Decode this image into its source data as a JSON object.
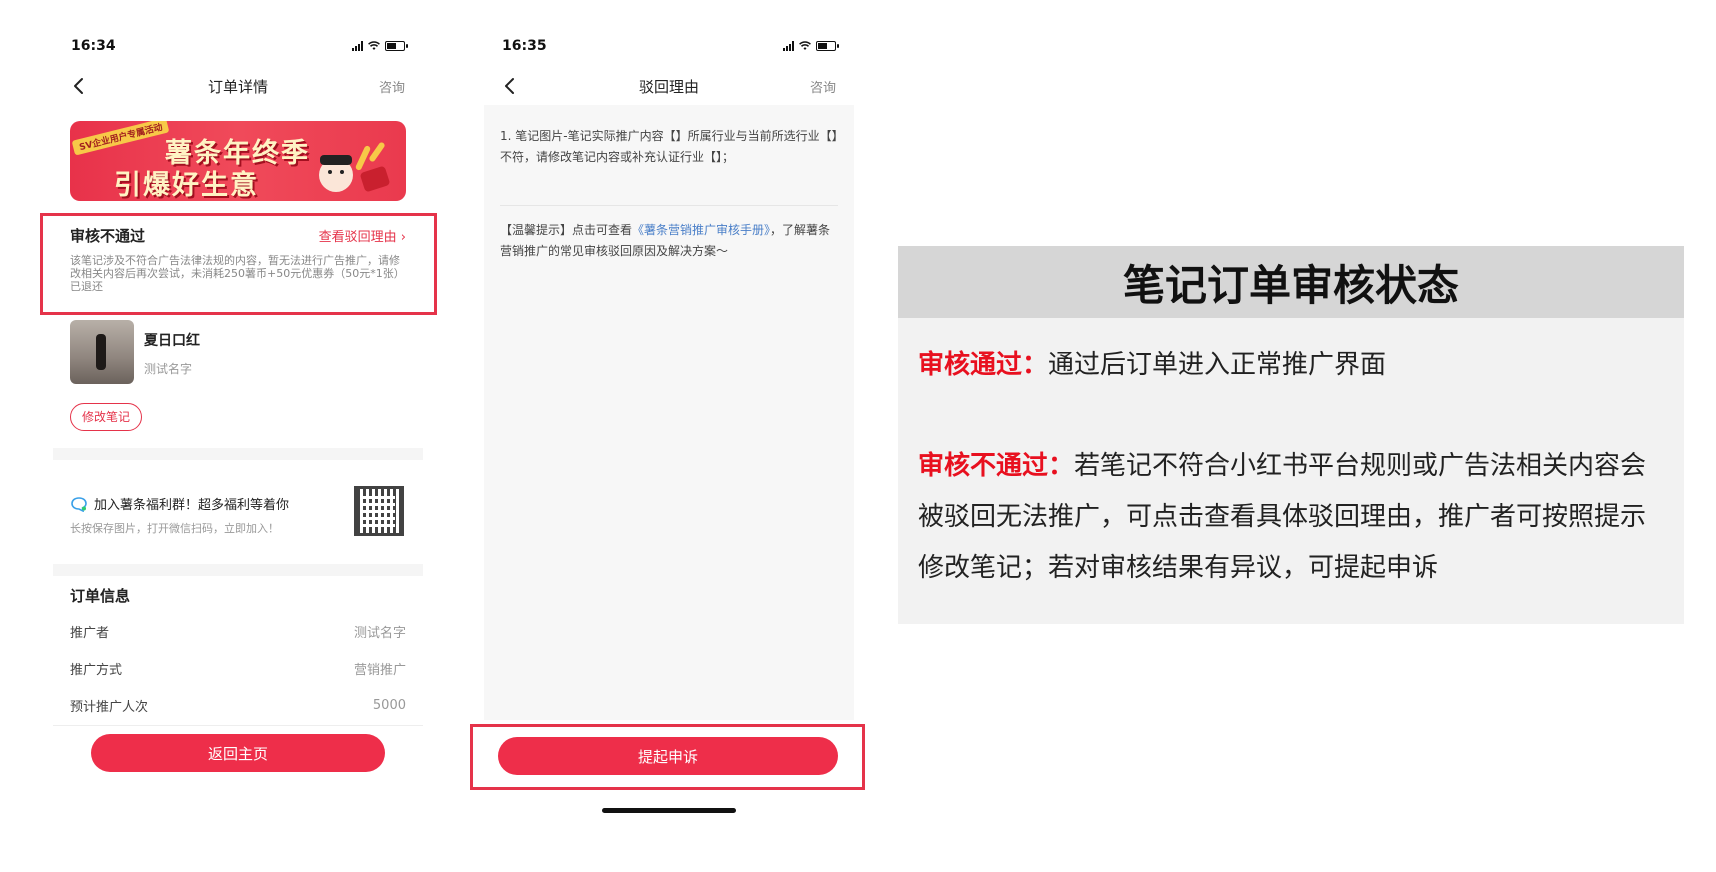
{
  "phone1": {
    "status_time": "16:34",
    "nav_title": "订单详情",
    "nav_right": "咨询",
    "banner": {
      "tag": "SV企业用户专属活动",
      "line1": "薯条年终季",
      "line2": "引爆好生意"
    },
    "reject": {
      "title": "审核不通过",
      "link": "查看驳回理由 ›",
      "desc": "该笔记涉及不符合广告法律法规的内容，暂无法进行广告推广，请修改相关内容后再次尝试，未消耗250薯币+50元优惠券（50元*1张）已退还"
    },
    "note": {
      "title": "夏日口红",
      "author": "测试名字",
      "edit_button": "修改笔记"
    },
    "group": {
      "title": "加入薯条福利群！超多福利等着你",
      "subtitle": "长按保存图片，打开微信扫码，立即加入！"
    },
    "order_info": {
      "title": "订单信息",
      "rows": [
        {
          "label": "推广者",
          "value": "测试名字"
        },
        {
          "label": "推广方式",
          "value": "营销推广"
        },
        {
          "label": "预计推广人次",
          "value": "5000"
        }
      ]
    },
    "home_button": "返回主页"
  },
  "phone2": {
    "status_time": "16:35",
    "nav_title": "驳回理由",
    "nav_right": "咨询",
    "reason": "1. 笔记图片-笔记实际推广内容【】所属行业与当前所选行业【】不符，请修改笔记内容或补充认证行业【】；",
    "tip_prefix": "【温馨提示】点击可查看",
    "tip_link": "《薯条营销推广审核手册》",
    "tip_suffix": "，了解薯条营销推广的常见审核驳回原因及解决方案～",
    "appeal_button": "提起申诉"
  },
  "panel": {
    "title": "笔记订单审核状态",
    "pass_label": "审核通过：",
    "pass_text": "通过后订单进入正常推广界面",
    "fail_label": "审核不通过：",
    "fail_text": "若笔记不符合小红书平台规则或广告法相关内容会被驳回无法推广，可点击查看具体驳回理由，推广者可按照提示修改笔记；若对审核结果有异议，可提起申诉"
  },
  "colors": {
    "accent": "#ee2e4a",
    "highlight": "#e5334a",
    "keyword": "#e8101f",
    "link": "#4a7fc8"
  }
}
